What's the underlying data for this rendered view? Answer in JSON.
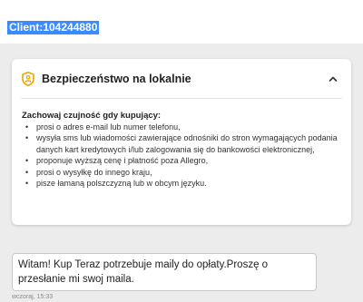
{
  "header": {
    "client_id": "Client:104244880"
  },
  "security_card": {
    "icon": "shield-person-icon",
    "title": "Bezpieczeństwo na lokalnie",
    "toggle_icon": "chevron-up-icon",
    "warning_heading": "Zachowaj czujność gdy kupujący:",
    "items": [
      "prosi o adres e-mail lub numer telefonu,",
      "wysyła sms lub wiadomości zawierające odnośniki do stron wymagających podania danych kart kredytowych i/lub zalogowania się do bankowości elektronicznej,",
      "proponuje wyższą cenę i płatność poza Allegro,",
      "prosi o wysyłkę do innego kraju,",
      "pisze łamaną polszczyzną lub w obcym języku."
    ],
    "accent_color": "#f0a500"
  },
  "message": {
    "text": "Witam! Kup Teraz potrzebuje maily do opłaty.Proszę o przesłanie mi swoj maila.",
    "timestamp": "wczoraj, 15:33"
  },
  "colors": {
    "selection": "#3a8bff",
    "background": "#ececec"
  }
}
